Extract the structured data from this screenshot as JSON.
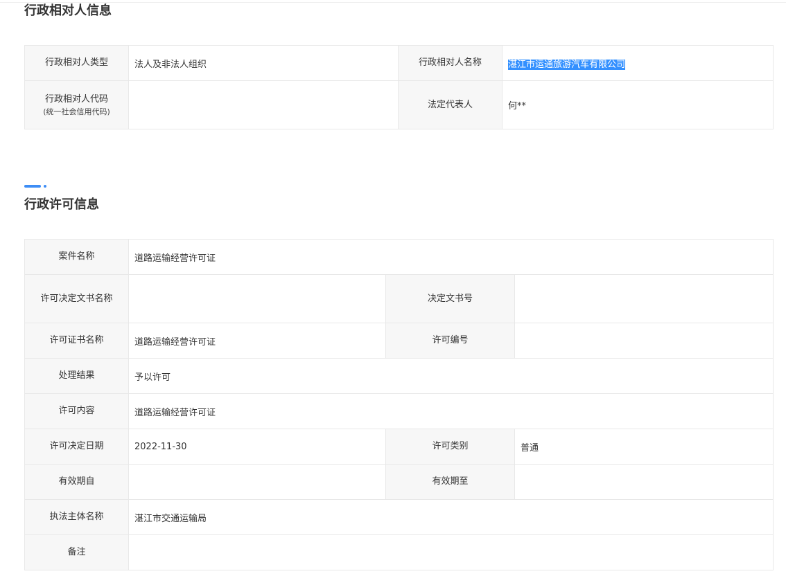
{
  "party_section": {
    "title": "行政相对人信息",
    "rows": [
      {
        "label_left": "行政相对人类型",
        "value_left": "法人及非法人组织",
        "label_right": "行政相对人名称",
        "value_right": "湛江市运通旅游汽车有限公司"
      },
      {
        "label_left": "行政相对人代码",
        "label_left_sub": "(统一社会信用代码)",
        "value_left": "",
        "label_right": "法定代表人",
        "value_right": "何**"
      }
    ]
  },
  "license_section": {
    "title": "行政许可信息",
    "case_name": {
      "label": "案件名称",
      "value": "道路运输经营许可证"
    },
    "decision_doc_name": {
      "label": "许可决定文书名称",
      "value": ""
    },
    "decision_doc_no": {
      "label": "决定文书号",
      "value": ""
    },
    "cert_name": {
      "label": "许可证书名称",
      "value": "道路运输经营许可证"
    },
    "license_no": {
      "label": "许可编号",
      "value": ""
    },
    "result": {
      "label": "处理结果",
      "value": "予以许可"
    },
    "content": {
      "label": "许可内容",
      "value": "道路运输经营许可证"
    },
    "decision_date": {
      "label": "许可决定日期",
      "value": "2022-11-30"
    },
    "category": {
      "label": "许可类别",
      "value": "普通"
    },
    "valid_from": {
      "label": "有效期自",
      "value": ""
    },
    "valid_to": {
      "label": "有效期至",
      "value": ""
    },
    "authority": {
      "label": "执法主体名称",
      "value": "湛江市交通运输局"
    },
    "remarks": {
      "label": "备注",
      "value": ""
    }
  },
  "colors": {
    "accent": "#3d8df5",
    "label_bg": "#f7f7f7",
    "border": "#e8e8e8",
    "selection": "#3390ff"
  }
}
